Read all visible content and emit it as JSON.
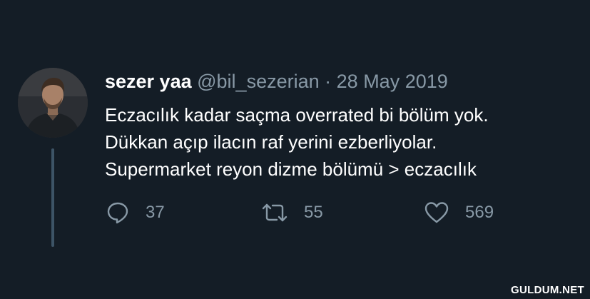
{
  "tweet": {
    "display_name": "sezer yaa",
    "handle": "@bil_sezerian",
    "separator": "·",
    "date": "28 May 2019",
    "lines": [
      "Eczacılık kadar saçma overrated bi bölüm yok.",
      "Dükkan açıp ilacın raf yerini ezberliyolar.",
      "Supermarket reyon dizme bölümü > eczacılık"
    ]
  },
  "actions": {
    "reply": {
      "icon": "reply-icon",
      "count": "37"
    },
    "retweet": {
      "icon": "retweet-icon",
      "count": "55"
    },
    "like": {
      "icon": "heart-icon",
      "count": "569"
    }
  },
  "watermark": "GULDUM.NET",
  "colors": {
    "background": "#141d26",
    "text": "#ffffff",
    "muted": "#8899a6",
    "thread_line": "#3d5466"
  }
}
